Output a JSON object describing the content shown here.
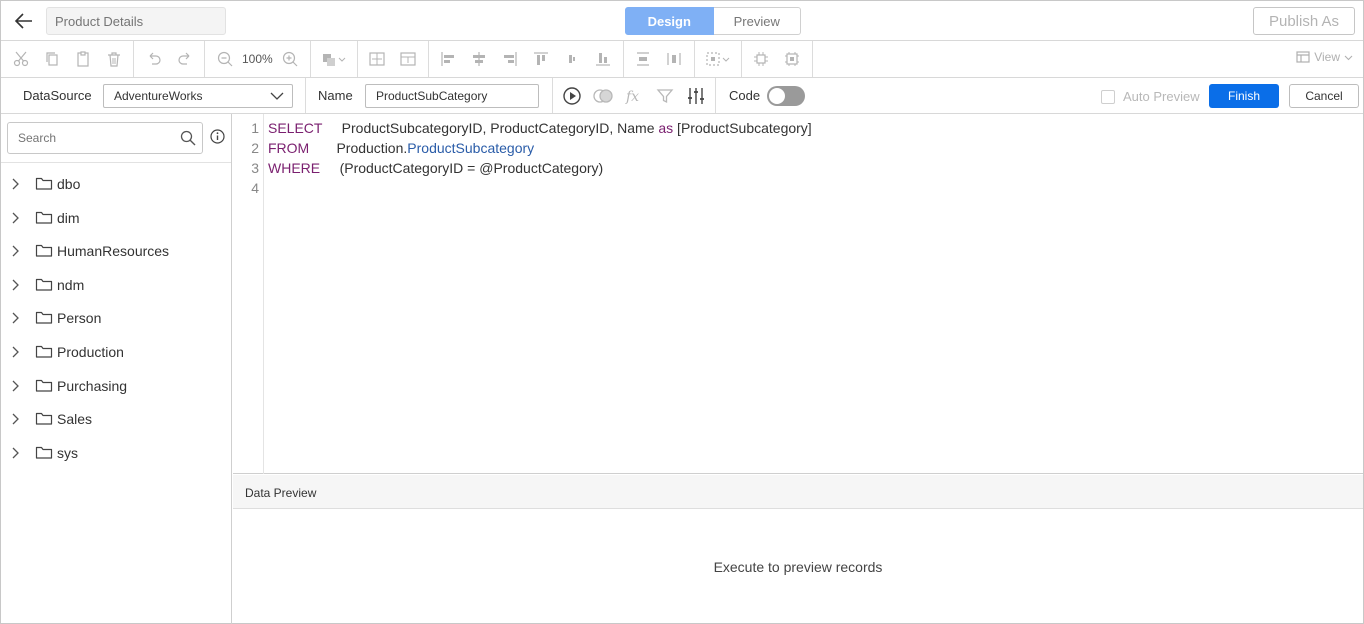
{
  "header": {
    "report_name_placeholder": "Product Details",
    "design_tab": "Design",
    "preview_tab": "Preview",
    "publish_label": "Publish As"
  },
  "toolbar": {
    "zoom": "100%",
    "view_label": "View"
  },
  "query": {
    "datasource_label": "DataSource",
    "datasource_value": "AdventureWorks",
    "name_label": "Name",
    "name_value": "ProductSubCategory",
    "code_label": "Code",
    "auto_preview_label": "Auto Preview",
    "finish_label": "Finish",
    "cancel_label": "Cancel"
  },
  "sidebar": {
    "search_placeholder": "Search",
    "items": [
      {
        "label": "dbo"
      },
      {
        "label": "dim"
      },
      {
        "label": "HumanResources"
      },
      {
        "label": "ndm"
      },
      {
        "label": "Person"
      },
      {
        "label": "Production"
      },
      {
        "label": "Purchasing"
      },
      {
        "label": "Sales"
      },
      {
        "label": "sys"
      }
    ]
  },
  "editor": {
    "line_numbers": [
      "1",
      "2",
      "3",
      "4"
    ],
    "lines": [
      {
        "kw": "SELECT",
        "pad": "     ",
        "rest": "ProductSubcategoryID, ProductCategoryID, Name ",
        "kw2": "as",
        "rest2": " [ProductSubcategory]"
      },
      {
        "kw": "FROM",
        "pad": "       ",
        "rest": "Production.",
        "tbl": "ProductSubcategory"
      },
      {
        "kw": "WHERE",
        "pad": "     ",
        "rest": "(ProductCategoryID = @ProductCategory)"
      }
    ]
  },
  "data_preview": {
    "title": "Data Preview",
    "empty_message": "Execute to preview records"
  },
  "colors": {
    "accent": "#0a6ee8",
    "design_tab": "#7fb0f5",
    "keyword": "#7a1f6f",
    "table_name": "#2a5ca8"
  }
}
